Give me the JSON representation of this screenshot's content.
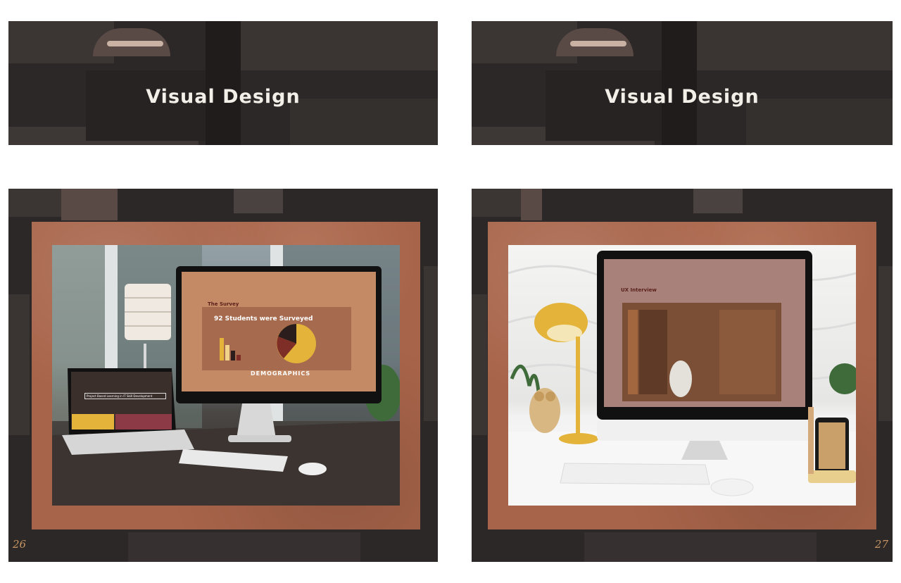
{
  "spread": {
    "left": {
      "banner_title": "Visual Design",
      "page_number": "26"
    },
    "right": {
      "banner_title": "Visual Design",
      "page_number": "27"
    }
  },
  "mockup_left": {
    "monitor_heading": "The Survey",
    "monitor_title": "92 Students were Surveyed",
    "monitor_footer": "DEMOGRAPHICS",
    "laptop_header": "Project Based Learning in IT Skill Development"
  },
  "mockup_right": {
    "monitor_heading": "UX Interview"
  },
  "colors": {
    "panel_bg": "#2b2827",
    "frame": "#a8644a",
    "screen_tan": "#c48a66",
    "accent_gold": "#e3b33a"
  }
}
